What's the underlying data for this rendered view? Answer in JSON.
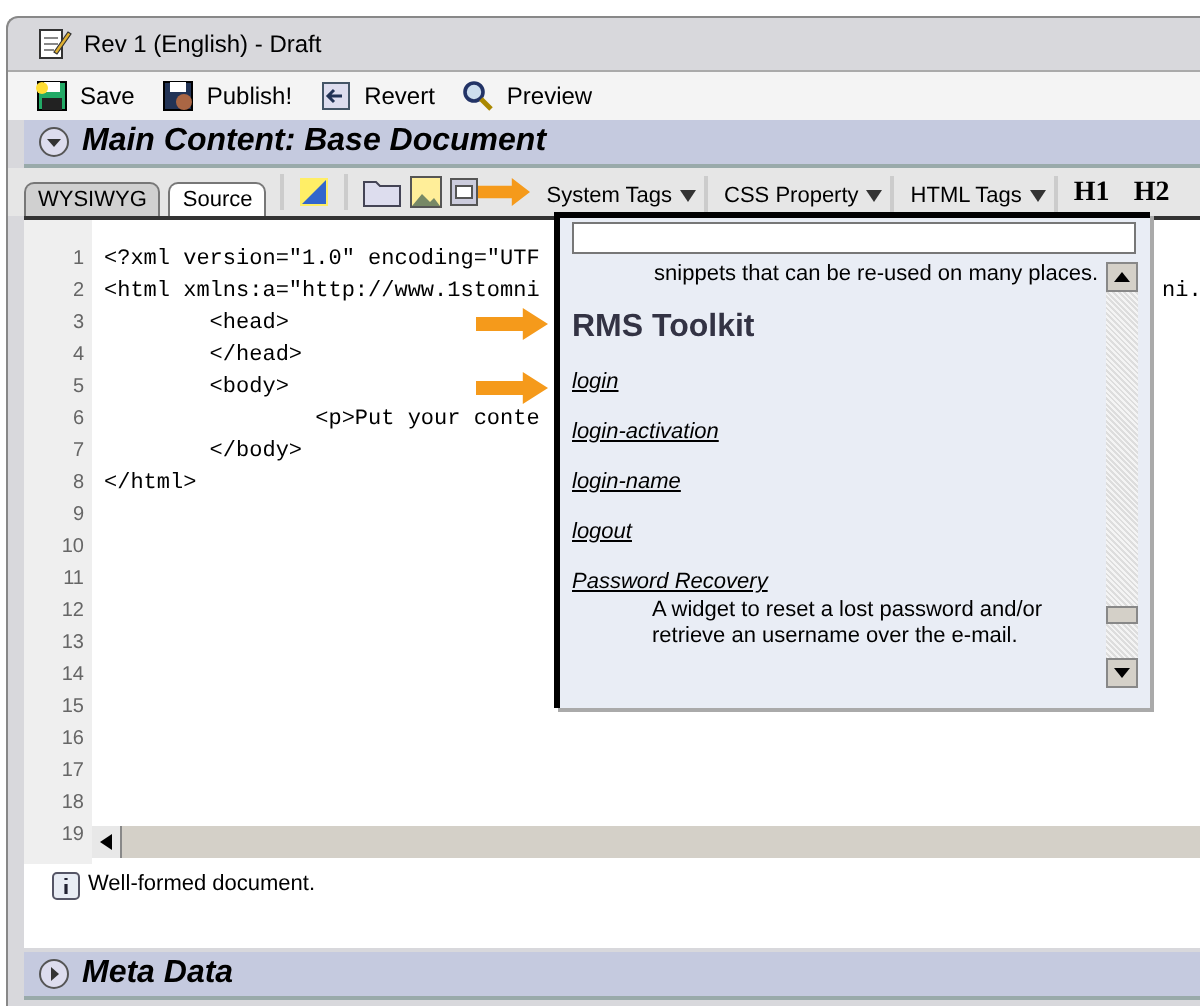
{
  "window": {
    "title": "Rev 1 (English) - Draft"
  },
  "toolbar": [
    {
      "label": "Save",
      "kind": "save"
    },
    {
      "label": "Publish!",
      "kind": "publish"
    },
    {
      "label": "Revert",
      "kind": "revert"
    },
    {
      "label": "Preview",
      "kind": "preview"
    }
  ],
  "main_section": {
    "title": "Main Content: Base Document",
    "expanded": true
  },
  "editor_tabs": [
    {
      "label": "WYSIWYG",
      "selected": false
    },
    {
      "label": "Source",
      "selected": true
    }
  ],
  "format_menus": [
    "System Tags",
    "CSS Property",
    "HTML Tags"
  ],
  "heading_buttons": [
    "H1",
    "H2"
  ],
  "code_lines": [
    {
      "number": "1",
      "text": "<?xml version=\"1.0\" encoding=\"UTF"
    },
    {
      "number": "2",
      "text": "<html xmlns:a=\"http://www.1stomni",
      "tail": "ni."
    },
    {
      "number": "3",
      "text": "        <head>"
    },
    {
      "number": "4",
      "text": "        </head>"
    },
    {
      "number": "5",
      "text": "        <body>"
    },
    {
      "number": "6",
      "text": "                <p>Put your conte"
    },
    {
      "number": "7",
      "text": "        </body>"
    },
    {
      "number": "8",
      "text": "</html>"
    },
    {
      "number": "9"
    },
    {
      "number": "10"
    },
    {
      "number": "11"
    },
    {
      "number": "12"
    },
    {
      "number": "13"
    },
    {
      "number": "14"
    },
    {
      "number": "15"
    },
    {
      "number": "16"
    },
    {
      "number": "17"
    },
    {
      "number": "18"
    },
    {
      "number": "19"
    }
  ],
  "tag_popup": {
    "intro": "snippets that can be re-used on many places.",
    "group_title": "RMS Toolkit",
    "items": [
      {
        "name": "login"
      },
      {
        "name": "login-activation"
      },
      {
        "name": "login-name"
      },
      {
        "name": "logout"
      },
      {
        "name": "Password Recovery",
        "description": "A widget to reset a lost password and/or retrieve an username over the e-mail."
      }
    ]
  },
  "status": "Well-formed document.",
  "meta_section": {
    "title": "Meta Data",
    "expanded": false
  }
}
